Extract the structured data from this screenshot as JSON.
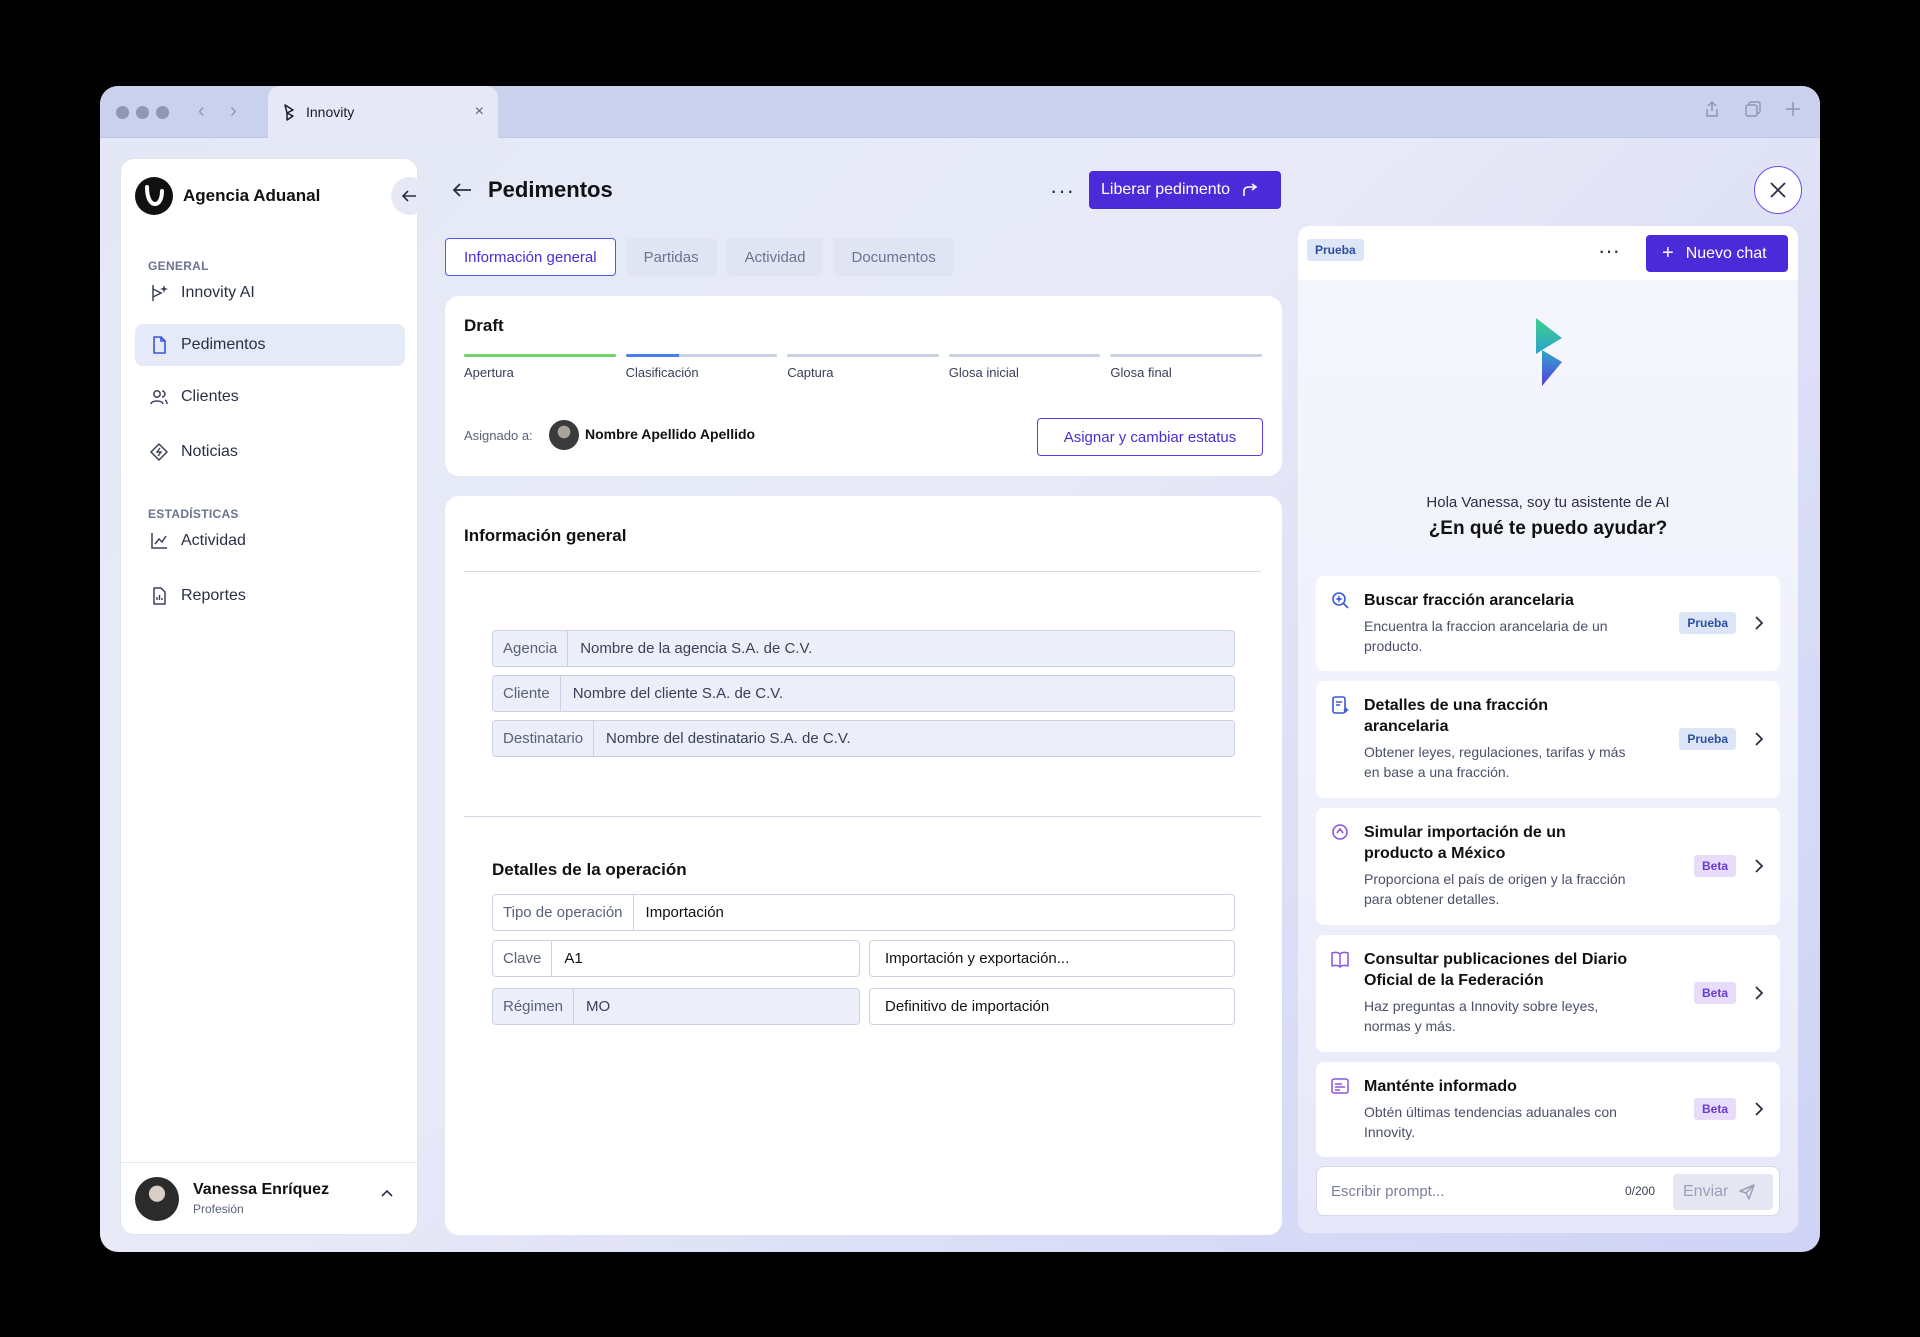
{
  "browser": {
    "tab_title": "Innovity",
    "tab_close": "×",
    "nav_back": "‹",
    "nav_forward": "›"
  },
  "sidebar": {
    "brand": "Agencia Aduanal",
    "sections": [
      {
        "label": "GENERAL"
      },
      {
        "label": "ESTADÍSTICAS"
      }
    ],
    "items": [
      {
        "label": "Innovity AI",
        "icon": "ai-sparkle-icon"
      },
      {
        "label": "Pedimentos",
        "icon": "document-icon",
        "active": true
      },
      {
        "label": "Clientes",
        "icon": "users-icon"
      },
      {
        "label": "Noticias",
        "icon": "news-diamond-icon"
      },
      {
        "label": "Actividad",
        "icon": "line-chart-icon"
      },
      {
        "label": "Reportes",
        "icon": "report-icon"
      }
    ],
    "user": {
      "name": "Vanessa Enríquez",
      "role": "Profesión"
    }
  },
  "header": {
    "title": "Pedimentos",
    "more": "···",
    "primary_action": "Liberar pedimento"
  },
  "tabs": [
    {
      "label": "Información general",
      "active": true
    },
    {
      "label": "Partidas"
    },
    {
      "label": "Actividad"
    },
    {
      "label": "Documentos"
    }
  ],
  "status": {
    "label": "Draft",
    "steps": [
      {
        "label": "Apertura",
        "progress": 1.0,
        "color": "#6fd36a"
      },
      {
        "label": "Clasificación",
        "progress": 0.35,
        "color": "#4a7df0"
      },
      {
        "label": "Captura",
        "progress": 0
      },
      {
        "label": "Glosa inicial",
        "progress": 0
      },
      {
        "label": "Glosa final",
        "progress": 0
      }
    ],
    "assigned_label": "Asignado a:",
    "assigned_name": "Nombre Apellido Apellido",
    "assign_button": "Asignar y cambiar estatus"
  },
  "info": {
    "title": "Información general",
    "fields": [
      {
        "label": "Agencia",
        "value": "Nombre de la agencia S.A. de C.V."
      },
      {
        "label": "Cliente",
        "value": "Nombre del cliente S.A. de C.V."
      },
      {
        "label": "Destinatario",
        "value": "Nombre del destinatario S.A. de C.V."
      }
    ],
    "ops_title": "Detalles de la operación",
    "tipo_label": "Tipo de operación",
    "tipo_value": "Importación",
    "clave_label": "Clave",
    "clave_value": "A1",
    "clave_desc": "Importación y exportación...",
    "regimen_label": "Régimen",
    "regimen_value": "MO",
    "regimen_desc": "Definitivo de importación"
  },
  "ai": {
    "top_badge": "Prueba",
    "more": "···",
    "new_chat": "Nuevo chat",
    "greeting": "Hola Vanessa, soy tu asistente de AI",
    "question": "¿En qué te puedo ayudar?",
    "cards": [
      {
        "title": "Buscar fracción arancelaria",
        "desc": "Encuentra la fraccion arancelaria de un producto.",
        "badge": "Prueba",
        "icon": "search-sparkle-icon"
      },
      {
        "title": "Detalles de una fracción arancelaria",
        "desc": "Obtener leyes, regulaciones, tarifas y más en base a una fracción.",
        "badge": "Prueba",
        "icon": "document-sparkle-icon"
      },
      {
        "title": "Simular importación de un producto a México",
        "desc": "Proporciona el país de origen y la fracción para obtener detalles.",
        "badge": "Beta",
        "icon": "simulate-icon"
      },
      {
        "title": "Consultar publicaciones del Diario Oficial de la Federación",
        "desc": "Haz preguntas a Innovity sobre leyes, normas y más.",
        "badge": "Beta",
        "icon": "book-icon"
      },
      {
        "title": "Manténte informado",
        "desc": "Obtén últimas tendencias aduanales con Innovity.",
        "badge": "Beta",
        "icon": "news-icon"
      }
    ],
    "prompt_placeholder": "Escribir prompt...",
    "prompt_count": "0/200",
    "send": "Enviar"
  }
}
